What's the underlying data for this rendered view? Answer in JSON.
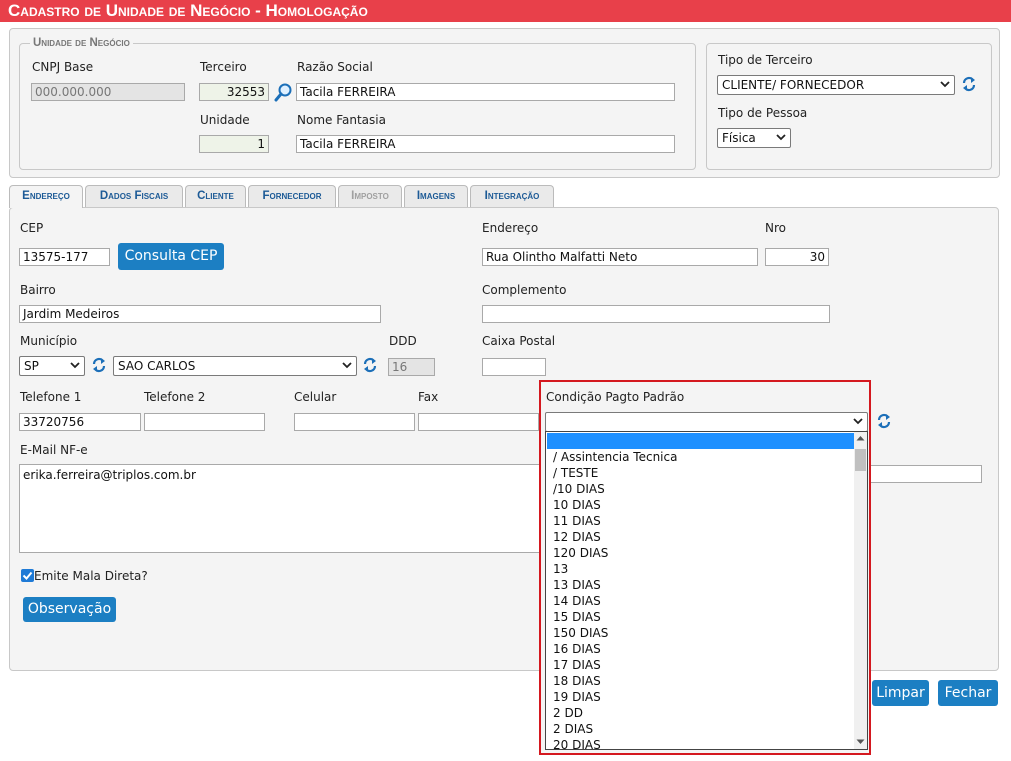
{
  "app": {
    "title": "Cadastro de Unidade de Negócio  - Homologação"
  },
  "unidade": {
    "legend": "Unidade de Negócio",
    "cnpj_label": "CNPJ Base",
    "cnpj_value": "000.000.000",
    "terceiro_label": "Terceiro",
    "terceiro_value": "32553",
    "razao_label": "Razão Social",
    "razao_value": "Tacila FERREIRA",
    "unidade_label": "Unidade",
    "unidade_value": "1",
    "fantasia_label": "Nome Fantasia",
    "fantasia_value": "Tacila FERREIRA"
  },
  "tipo": {
    "terceiro_label": "Tipo de Terceiro",
    "terceiro_value": "CLIENTE/ FORNECEDOR",
    "pessoa_label": "Tipo de Pessoa",
    "pessoa_value": "Física"
  },
  "tabs": [
    {
      "label": "Endereço"
    },
    {
      "label": "Dados Fiscais"
    },
    {
      "label": "Cliente"
    },
    {
      "label": "Fornecedor"
    },
    {
      "label": "Imposto"
    },
    {
      "label": "Imagens"
    },
    {
      "label": "Integração"
    }
  ],
  "endereco": {
    "cep_label": "CEP",
    "cep_value": "13575-177",
    "consulta_button": "Consulta CEP",
    "endereco_label": "Endereço",
    "endereco_value": "Rua Olintho Malfatti Neto",
    "nro_label": "Nro",
    "nro_value": "30",
    "bairro_label": "Bairro",
    "bairro_value": "Jardim Medeiros",
    "complemento_label": "Complemento",
    "complemento_value": "",
    "municipio_label": "Município",
    "uf_value": "SP",
    "cidade_value": "SAO CARLOS",
    "ddd_label": "DDD",
    "ddd_value": "16",
    "caixa_label": "Caixa Postal",
    "caixa_value": "",
    "tel1_label": "Telefone 1",
    "tel1_value": "33720756",
    "tel2_label": "Telefone 2",
    "tel2_value": "",
    "celular_label": "Celular",
    "celular_value": "",
    "fax_label": "Fax",
    "fax_value": "",
    "condicao_label": "Condição Pagto Padrão",
    "condicao_value": "",
    "email_label": "E-Mail NF-e",
    "email_value": "erika.ferreira@triplos.com.br",
    "mala_label": "Emite Mala Direta?",
    "observacao_button": "Observação"
  },
  "footer": {
    "limpar": "Limpar",
    "fechar": "Fechar"
  },
  "dropdown": {
    "options": [
      "",
      "/ Assintencia Tecnica",
      "/ TESTE",
      "/10 DIAS",
      "10 DIAS",
      "11 DIAS",
      "12 DIAS",
      "120 DIAS",
      "13",
      "13 DIAS",
      "14 DIAS",
      "15 DIAS",
      "150 DIAS",
      "16 DIAS",
      "17 DIAS",
      "18 DIAS",
      "19 DIAS",
      "2 DD",
      "2 DIAS",
      "20 DIAS"
    ]
  },
  "colors": {
    "header": "#e8404a",
    "button": "#1c7fc3",
    "highlight": "#d4181f",
    "selected_option": "#1e90ff"
  }
}
